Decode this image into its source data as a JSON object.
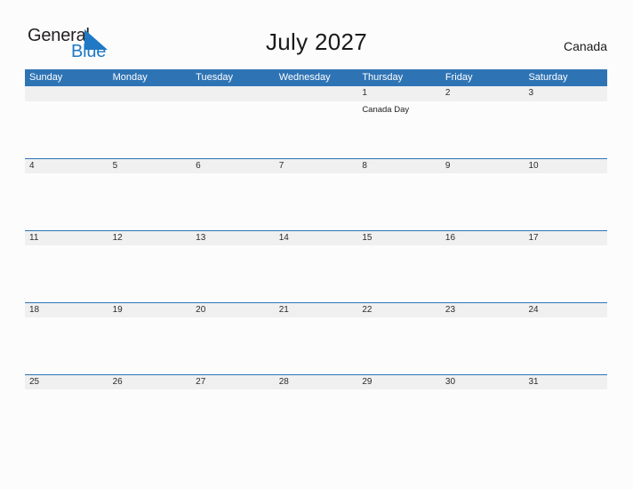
{
  "logo": {
    "word1": "General",
    "word2": "Blue",
    "triangle_color": "#1f79c4",
    "icon": "triangle-logo-icon"
  },
  "header": {
    "title": "July 2027",
    "country": "Canada"
  },
  "colors": {
    "header_blue": "#2e74b5",
    "date_band_gray": "#f0f0f0",
    "page_background": "#fcfcfc",
    "text": "#1a1a1a",
    "weekday_text": "#ffffff"
  },
  "calendar": {
    "weekdays": [
      "Sunday",
      "Monday",
      "Tuesday",
      "Wednesday",
      "Thursday",
      "Friday",
      "Saturday"
    ],
    "weeks": [
      {
        "days": [
          {
            "date": "",
            "events": []
          },
          {
            "date": "",
            "events": []
          },
          {
            "date": "",
            "events": []
          },
          {
            "date": "",
            "events": []
          },
          {
            "date": "1",
            "events": [
              "Canada Day"
            ]
          },
          {
            "date": "2",
            "events": []
          },
          {
            "date": "3",
            "events": []
          }
        ]
      },
      {
        "days": [
          {
            "date": "4",
            "events": []
          },
          {
            "date": "5",
            "events": []
          },
          {
            "date": "6",
            "events": []
          },
          {
            "date": "7",
            "events": []
          },
          {
            "date": "8",
            "events": []
          },
          {
            "date": "9",
            "events": []
          },
          {
            "date": "10",
            "events": []
          }
        ]
      },
      {
        "days": [
          {
            "date": "11",
            "events": []
          },
          {
            "date": "12",
            "events": []
          },
          {
            "date": "13",
            "events": []
          },
          {
            "date": "14",
            "events": []
          },
          {
            "date": "15",
            "events": []
          },
          {
            "date": "16",
            "events": []
          },
          {
            "date": "17",
            "events": []
          }
        ]
      },
      {
        "days": [
          {
            "date": "18",
            "events": []
          },
          {
            "date": "19",
            "events": []
          },
          {
            "date": "20",
            "events": []
          },
          {
            "date": "21",
            "events": []
          },
          {
            "date": "22",
            "events": []
          },
          {
            "date": "23",
            "events": []
          },
          {
            "date": "24",
            "events": []
          }
        ]
      },
      {
        "days": [
          {
            "date": "25",
            "events": []
          },
          {
            "date": "26",
            "events": []
          },
          {
            "date": "27",
            "events": []
          },
          {
            "date": "28",
            "events": []
          },
          {
            "date": "29",
            "events": []
          },
          {
            "date": "30",
            "events": []
          },
          {
            "date": "31",
            "events": []
          }
        ]
      }
    ]
  }
}
